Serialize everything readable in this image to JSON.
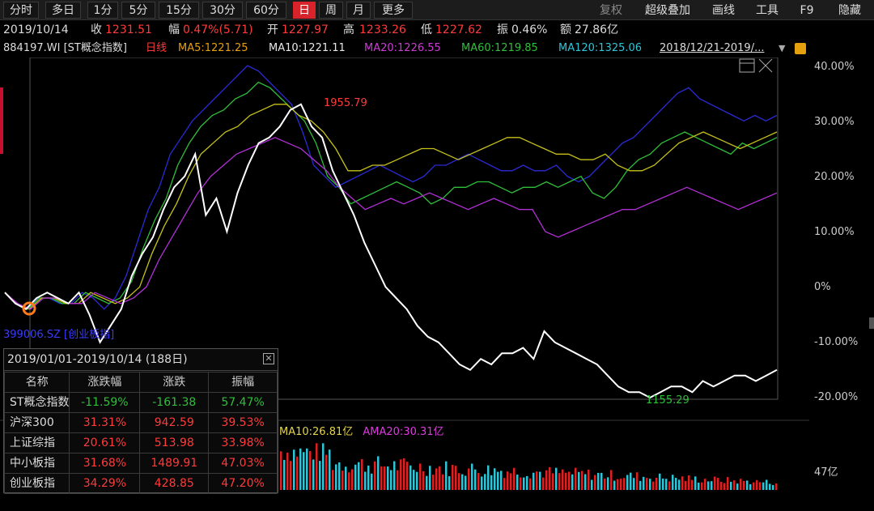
{
  "toolbar": {
    "left_items": [
      {
        "label": "分时",
        "active": false
      },
      {
        "label": "多日",
        "active": false
      },
      {
        "label": "1分",
        "active": false
      },
      {
        "label": "5分",
        "active": false
      },
      {
        "label": "15分",
        "active": false
      },
      {
        "label": "30分",
        "active": false
      },
      {
        "label": "60分",
        "active": false
      },
      {
        "label": "日",
        "active": true
      },
      {
        "label": "周",
        "active": false
      },
      {
        "label": "月",
        "active": false
      },
      {
        "label": "更多",
        "active": false
      }
    ],
    "right_items": [
      "复权",
      "超级叠加",
      "画线",
      "工具",
      "F9",
      "隐藏"
    ]
  },
  "quote": {
    "date": "2019/10/14",
    "close_label": "收",
    "close": "1231.51",
    "change_label": "幅",
    "change": "0.47%(5.71)",
    "open_label": "开",
    "open": "1227.97",
    "high_label": "高",
    "high": "1233.26",
    "low_label": "低",
    "low": "1227.62",
    "amplitude_label": "振",
    "amplitude": "0.46%",
    "amount_label": "额",
    "amount": "27.86亿"
  },
  "ma_bar": {
    "code": "884197.WI [ST概念指数]",
    "period": "日线",
    "ma5": "MA5:1221.25",
    "ma10": "MA10:1221.11",
    "ma20": "MA20:1226.55",
    "ma60": "MA60:1219.85",
    "ma120": "MA120:1325.06",
    "range": "2018/12/21-2019/...",
    "colors": {
      "ma5": "#e5a00d",
      "ma10": "#e8e8e8",
      "ma20": "#cc3bd6",
      "ma60": "#2fbf3a",
      "ma120": "#2fc5d6"
    }
  },
  "chart": {
    "y_ticks": [
      "40.00%",
      "30.00%",
      "20.00%",
      "10.00%",
      "0%",
      "-10.00%",
      "-20.00%"
    ],
    "high_marker": "1955.79",
    "low_marker": "1155.29",
    "overlay_label": "399006.SZ [创业板指]",
    "volume_tick": "47亿"
  },
  "chart_data": {
    "type": "line",
    "y_unit": "%",
    "ylim": [
      -20,
      40
    ],
    "series": [
      {
        "name": "ST概念指数",
        "color": "#ffffff",
        "values": [
          -1,
          -3,
          -4,
          -2,
          -1,
          -2,
          -3,
          -1,
          -5,
          -10,
          -7,
          -4,
          2,
          6,
          9,
          14,
          18,
          20,
          24,
          13,
          16,
          10,
          17,
          22,
          26,
          27,
          29,
          32,
          33,
          29,
          27,
          21,
          17,
          13,
          8,
          4,
          0,
          -2,
          -4,
          -7,
          -9,
          -10,
          -12,
          -14,
          -15,
          -13,
          -14,
          -12,
          -12,
          -11,
          -13,
          -8,
          -10,
          -11,
          -12,
          -13,
          -14,
          -16,
          -18,
          -19,
          -19,
          -20,
          -19,
          -18,
          -18,
          -19,
          -17,
          -18,
          -17,
          -16,
          -16,
          -17,
          -16,
          -15
        ]
      },
      {
        "name": "中小板指",
        "color": "#2b2bd6",
        "values": [
          -1,
          -3,
          -4,
          -2,
          -2,
          -3,
          -3,
          -1,
          -2,
          -4,
          -2,
          2,
          8,
          14,
          18,
          24,
          27,
          30,
          32,
          34,
          36,
          38,
          40,
          39,
          37,
          35,
          33,
          28,
          22,
          20,
          18,
          19,
          20,
          21,
          22,
          21,
          20,
          19,
          20,
          22,
          22,
          23,
          24,
          23,
          22,
          21,
          21,
          22,
          21,
          21,
          22,
          20,
          19,
          20,
          22,
          24,
          26,
          27,
          29,
          31,
          33,
          35,
          36,
          34,
          33,
          32,
          31,
          30,
          31,
          30,
          31
        ]
      },
      {
        "name": "沪深300",
        "color": "#2fbf3a",
        "values": [
          -1,
          -3,
          -4,
          -2,
          -2,
          -3,
          -3,
          -1,
          -2,
          -3,
          -2,
          1,
          7,
          12,
          16,
          22,
          26,
          29,
          31,
          32,
          34,
          35,
          37,
          36,
          34,
          32,
          30,
          26,
          20,
          18,
          15,
          16,
          17,
          18,
          19,
          18,
          17,
          15,
          16,
          18,
          18,
          19,
          19,
          18,
          17,
          18,
          18,
          19,
          18,
          19,
          20,
          17,
          16,
          18,
          21,
          23,
          24,
          26,
          27,
          28,
          27,
          26,
          25,
          24,
          26,
          25,
          26,
          27
        ]
      },
      {
        "name": "上证综指",
        "color": "#c7c21a",
        "values": [
          -1,
          -3,
          -4,
          -2,
          -2,
          -3,
          -3,
          -1,
          -2,
          -3,
          -2,
          0,
          6,
          11,
          15,
          20,
          24,
          26,
          28,
          29,
          31,
          32,
          33,
          33,
          31,
          30,
          28,
          25,
          21,
          21,
          22,
          22,
          23,
          24,
          25,
          25,
          24,
          23,
          24,
          25,
          26,
          27,
          27,
          26,
          25,
          24,
          24,
          23,
          23,
          24,
          22,
          21,
          21,
          22,
          24,
          26,
          27,
          28,
          27,
          26,
          25,
          26,
          27,
          28
        ]
      },
      {
        "name": "创业板指",
        "color": "#b12fd6",
        "values": [
          -1,
          -3,
          -4,
          -2,
          -2,
          -3,
          -3,
          -1,
          -2,
          -3,
          -2,
          0,
          5,
          9,
          13,
          17,
          20,
          22,
          24,
          25,
          26,
          27,
          26,
          25,
          23,
          21,
          18,
          16,
          14,
          15,
          16,
          15,
          16,
          17,
          16,
          15,
          14,
          15,
          16,
          15,
          14,
          14,
          10,
          9,
          10,
          11,
          12,
          13,
          14,
          14,
          15,
          16,
          17,
          18,
          17,
          16,
          15,
          14,
          15,
          16,
          17
        ]
      }
    ]
  },
  "volume_data": {
    "ama_labels": [
      "MA10:26.81亿",
      "AMA20:30.31亿"
    ]
  },
  "stats_panel": {
    "title": "2019/01/01-2019/10/14 (188日)",
    "headers": [
      "名称",
      "涨跌幅",
      "涨跌",
      "振幅"
    ],
    "rows": [
      {
        "name": "ST概念指数",
        "pct": "-11.59%",
        "chg": "-161.38",
        "amp": "57.47%"
      },
      {
        "name": "沪深300",
        "pct": "31.31%",
        "chg": "942.59",
        "amp": "39.53%"
      },
      {
        "name": "上证综指",
        "pct": "20.61%",
        "chg": "513.98",
        "amp": "33.98%"
      },
      {
        "name": "中小板指",
        "pct": "31.68%",
        "chg": "1489.91",
        "amp": "47.03%"
      },
      {
        "name": "创业板指",
        "pct": "34.29%",
        "chg": "428.85",
        "amp": "47.20%"
      }
    ]
  }
}
